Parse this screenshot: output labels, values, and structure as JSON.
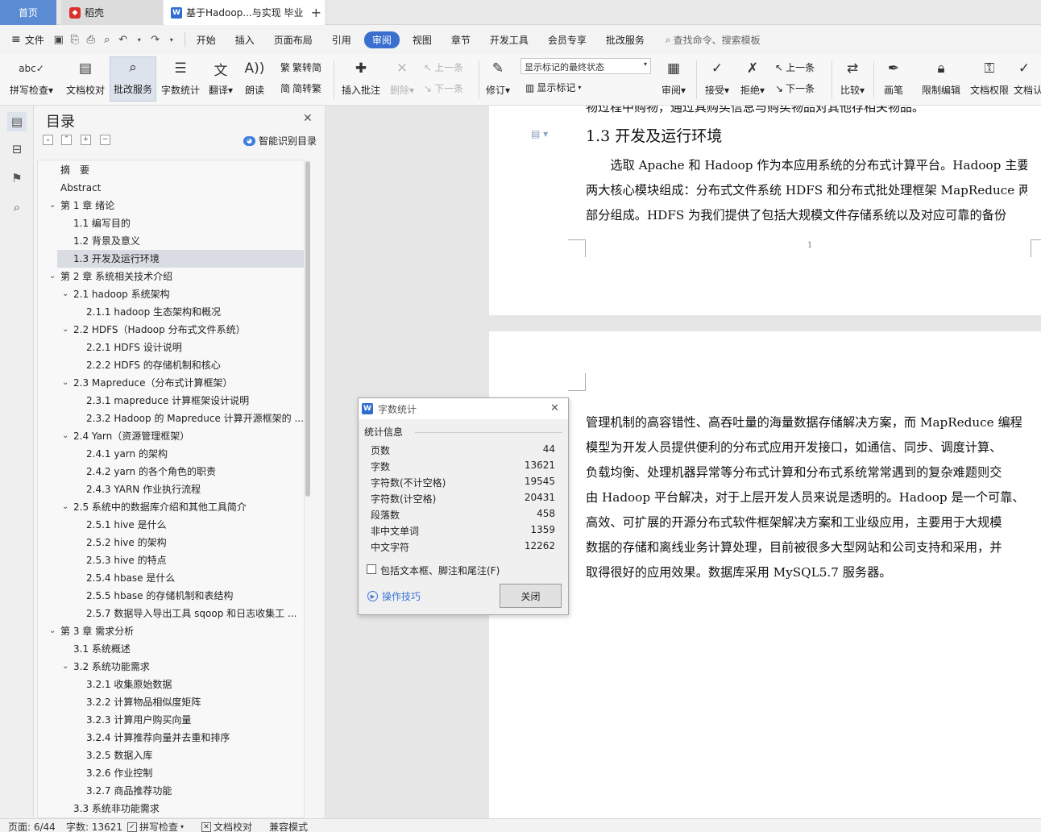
{
  "tabs": {
    "home": "首页",
    "daoke": "稻壳",
    "doc": "基于Hadoop...与实现 毕业"
  },
  "menu": {
    "file": "文件",
    "items": [
      "开始",
      "插入",
      "页面布局",
      "引用",
      "审阅",
      "视图",
      "章节",
      "开发工具",
      "会员专享",
      "批改服务"
    ],
    "active": "审阅",
    "search": "查找命令、搜索模板"
  },
  "ribbon": {
    "spellcheck": "拼写检查",
    "doccheck": "文档校对",
    "correction": "批改服务",
    "wordcount": "字数统计",
    "translate": "翻译",
    "read": "朗读",
    "trad": "繁转简",
    "simp": "简转繁",
    "insert_comment": "插入批注",
    "delete": "删除",
    "prev": "上一条",
    "next": "下一条",
    "revise": "修订",
    "markup_state": "显示标记的最终状态",
    "show_markup": "显示标记",
    "review": "审阅",
    "accept": "接受",
    "reject": "拒绝",
    "prev2": "上一条",
    "next2": "下一条",
    "compare": "比较",
    "pen": "画笔",
    "restrict": "限制编辑",
    "doc_perm": "文档权限",
    "doc_cut": "文档认"
  },
  "toc": {
    "title": "目录",
    "smart": "智能识别目录",
    "items": [
      {
        "text": "摘　要",
        "level": 0,
        "arrow": ""
      },
      {
        "text": "Abstract",
        "level": 0,
        "arrow": ""
      },
      {
        "text": "第 1 章  绪论",
        "level": 0,
        "arrow": "v"
      },
      {
        "text": "1.1  编写目的",
        "level": 1,
        "arrow": ""
      },
      {
        "text": "1.2  背景及意义",
        "level": 1,
        "arrow": ""
      },
      {
        "text": "1.3  开发及运行环境",
        "level": 1,
        "arrow": "",
        "selected": true
      },
      {
        "text": "第 2 章  系统相关技术介绍",
        "level": 0,
        "arrow": "v"
      },
      {
        "text": "2.1 hadoop 系统架构",
        "level": 1,
        "arrow": "v"
      },
      {
        "text": "2.1.1 hadoop  生态架构和概况",
        "level": 2,
        "arrow": ""
      },
      {
        "text": "2.2 HDFS（Hadoop 分布式文件系统）",
        "level": 1,
        "arrow": "v"
      },
      {
        "text": "2.2.1 HDFS  设计说明",
        "level": 2,
        "arrow": ""
      },
      {
        "text": "2.2.2 HDFS 的存储机制和核心",
        "level": 2,
        "arrow": ""
      },
      {
        "text": "2.3 Mapreduce（分布式计算框架）",
        "level": 1,
        "arrow": "v"
      },
      {
        "text": "2.3.1 mapreduce 计算框架设计说明",
        "level": 2,
        "arrow": ""
      },
      {
        "text": "2.3.2 Hadoop 的 Mapreduce 计算开源框架的 ...",
        "level": 2,
        "arrow": ""
      },
      {
        "text": "2.4 Yarn（资源管理框架）",
        "level": 1,
        "arrow": "v"
      },
      {
        "text": "2.4.1 yarn 的架构",
        "level": 2,
        "arrow": ""
      },
      {
        "text": "2.4.2 yarn 的各个角色的职责",
        "level": 2,
        "arrow": ""
      },
      {
        "text": "2.4.3 YARN  作业执行流程",
        "level": 2,
        "arrow": ""
      },
      {
        "text": "2.5  系统中的数据库介绍和其他工具简介",
        "level": 1,
        "arrow": "v"
      },
      {
        "text": "2.5.1 hive 是什么",
        "level": 2,
        "arrow": ""
      },
      {
        "text": "2.5.2 hive 的架构",
        "level": 2,
        "arrow": ""
      },
      {
        "text": "2.5.3 hive 的特点",
        "level": 2,
        "arrow": ""
      },
      {
        "text": "2.5.4 hbase 是什么",
        "level": 2,
        "arrow": ""
      },
      {
        "text": "2.5.5 hbase 的存储机制和表结构",
        "level": 2,
        "arrow": ""
      },
      {
        "text": "2.5.7  数据导入导出工具 sqoop 和日志收集工 ...",
        "level": 2,
        "arrow": ""
      },
      {
        "text": "第 3 章  需求分析",
        "level": 0,
        "arrow": "v"
      },
      {
        "text": "3.1  系统概述",
        "level": 1,
        "arrow": ""
      },
      {
        "text": "3.2  系统功能需求",
        "level": 1,
        "arrow": "v"
      },
      {
        "text": "3.2.1  收集原始数据",
        "level": 2,
        "arrow": ""
      },
      {
        "text": "3.2.2  计算物品相似度矩阵",
        "level": 2,
        "arrow": ""
      },
      {
        "text": "3.2.3  计算用户购买向量",
        "level": 2,
        "arrow": ""
      },
      {
        "text": "3.2.4  计算推荐向量并去重和排序",
        "level": 2,
        "arrow": ""
      },
      {
        "text": "3.2.5  数据入库",
        "level": 2,
        "arrow": ""
      },
      {
        "text": "3.2.6  作业控制",
        "level": 2,
        "arrow": ""
      },
      {
        "text": "3.2.7 商品推荐功能",
        "level": 2,
        "arrow": ""
      },
      {
        "text": "3.3  系统非功能需求",
        "level": 1,
        "arrow": ""
      }
    ]
  },
  "doc": {
    "cut_top": "物过程中购物，通过具购买信息与购买物品对其他存相关物品。",
    "heading": "1.3  开发及运行环境",
    "page1_lines": [
      "　　选取 Apache 和 Hadoop 作为本应用系统的分布式计算平台。Hadoop 主要由",
      "两大核心模块组成：分布式文件系统 HDFS 和分布式批处理框架 MapReduce 两",
      "部分组成。HDFS 为我们提供了包括大规模文件存储系统以及对应可靠的备份"
    ],
    "page_number": "1",
    "page2_lines": [
      "管理机制的高容错性、高吞吐量的海量数据存储解决方案，而 MapReduce 编程",
      "模型为开发人员提供便利的分布式应用开发接口，如通信、同步、调度计算、",
      "负载均衡、处理机器异常等分布式计算和分布式系统常常遇到的复杂难题则交",
      "由 Hadoop 平台解决，对于上层开发人员来说是透明的。Hadoop 是一个可靠、",
      "高效、可扩展的开源分布式软件框架解决方案和工业级应用，主要用于大规模",
      "数据的存储和离线业务计算处理，目前被很多大型网站和公司支持和采用，并",
      "取得很好的应用效果。数据库采用 MySQL5.7 服务器。"
    ]
  },
  "dialog": {
    "title": "字数统计",
    "section": "统计信息",
    "stats": [
      {
        "label": "页数",
        "value": "44"
      },
      {
        "label": "字数",
        "value": "13621"
      },
      {
        "label": "字符数(不计空格)",
        "value": "19545"
      },
      {
        "label": "字符数(计空格)",
        "value": "20431"
      },
      {
        "label": "段落数",
        "value": "458"
      },
      {
        "label": "非中文单词",
        "value": "1359"
      },
      {
        "label": "中文字符",
        "value": "12262"
      }
    ],
    "checkbox": "包括文本框、脚注和尾注(F)",
    "tips": "操作技巧",
    "close": "关闭"
  },
  "status": {
    "page": "页面: 6/44",
    "words": "字数: 13621",
    "spell": "拼写检查",
    "doccheck": "文档校对",
    "compat": "兼容模式"
  },
  "colors": {
    "accent": "#3a6fd0",
    "home_tab": "#5b8bd3",
    "link": "#3b73d9"
  }
}
